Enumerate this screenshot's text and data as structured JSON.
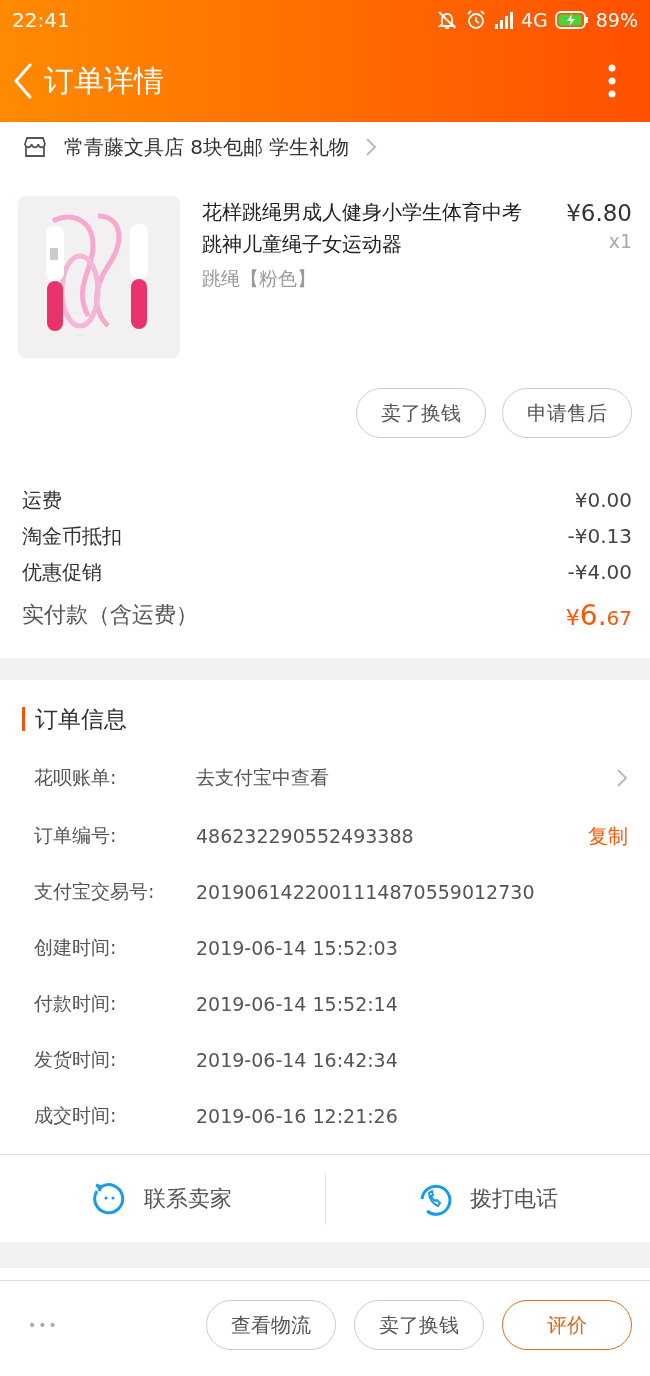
{
  "status_bar": {
    "time": "22:41",
    "network": "4G",
    "battery": "89%"
  },
  "header": {
    "title": "订单详情"
  },
  "shop": {
    "name": "常青藤文具店 8块包邮 学生礼物"
  },
  "product": {
    "kind": "picture",
    "title": "花样跳绳男成人健身小学生体育中考跳神儿童绳子女运动器",
    "price": "¥6.80",
    "quantity": "x1",
    "sku": "跳绳【粉色】",
    "buttons": [
      "卖了换钱",
      "申请售后"
    ]
  },
  "fees": [
    {
      "kind": "normal",
      "label": "运费",
      "value": "¥0.00"
    },
    {
      "kind": "normal",
      "label": "淘金币抵扣",
      "value": "-¥0.13"
    },
    {
      "kind": "normal",
      "label": "优惠促销",
      "value": "-¥4.00"
    },
    {
      "kind": "total",
      "label": "实付款（含运费）",
      "currency": "¥",
      "integer": "6.",
      "decimal": "67"
    }
  ],
  "order_info": {
    "title": "订单信息",
    "rows": [
      {
        "kind": "link",
        "label": "花呗账单:",
        "value": "去支付宝中查看"
      },
      {
        "kind": "copy",
        "label": "订单编号:",
        "value": "486232290552493388",
        "action": "复制"
      },
      {
        "kind": "plain",
        "label": "支付宝交易号:",
        "value": "2019061422001114870559012730"
      },
      {
        "kind": "plain",
        "label": "创建时间:",
        "value": "2019-06-14 15:52:03"
      },
      {
        "kind": "plain",
        "label": "付款时间:",
        "value": "2019-06-14 15:52:14"
      },
      {
        "kind": "plain",
        "label": "发货时间:",
        "value": "2019-06-14 16:42:34"
      },
      {
        "kind": "plain",
        "label": "成交时间:",
        "value": "2019-06-16 12:21:26"
      }
    ]
  },
  "contact": [
    {
      "kind": "chat",
      "label": "联系卖家"
    },
    {
      "kind": "phone",
      "label": "拨打电话"
    }
  ],
  "bottom_bar": {
    "more": "•••",
    "buttons": [
      {
        "label": "查看物流",
        "primary": false
      },
      {
        "label": "卖了换钱",
        "primary": false
      },
      {
        "label": "评价",
        "primary": true
      }
    ]
  }
}
